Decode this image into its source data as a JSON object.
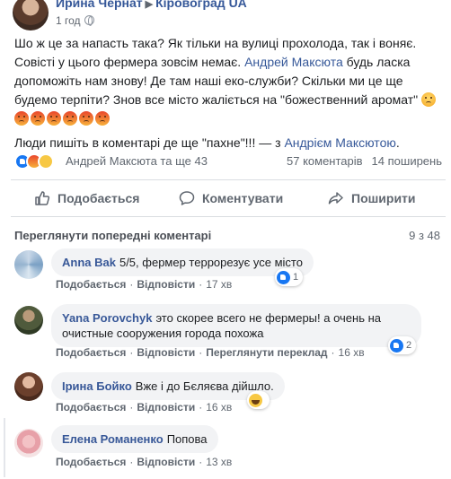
{
  "post": {
    "author": "Ирина Чернат",
    "arrow": "▶",
    "group": "Кіровоград UA",
    "time": "1 год",
    "text": {
      "p1_a": "Шо ж це за напасть така? Як тільки на вулиці прохолода, так і воняє. Совісті у цього фермера зовсім немає. ",
      "mention": "Андрей Максюта",
      "p1_b": " будь ласка допоможіть нам знову! Де там наші еко-служби? Скільки ми це ще будемо терпіти? Знов все місто жаліється на \"божественний аромат\"",
      "p2": "Люди пишіть в коментарі де ще \"пахне\"!!! — з ",
      "tag_person": "Андрієм Максютою",
      "p2_end": "."
    },
    "emoji": [
      "sad",
      "angry",
      "angry",
      "angry",
      "angry",
      "angry",
      "angry"
    ]
  },
  "stats": {
    "reactions_text": "Андрей Максюта та ще 43",
    "comments": "57 коментарів",
    "shares": "14 поширень"
  },
  "actions": {
    "like": "Подобається",
    "comment": "Коментувати",
    "share": "Поширити"
  },
  "comments_section": {
    "previous": "Переглянути попередні коментарі",
    "count": "9 з 48"
  },
  "comments": [
    {
      "name": "Anna Bak",
      "text": "5/5, фермер террорезує усе місто",
      "like": "Подобається",
      "reply": "Відповісти",
      "time": "17 хв",
      "reactions": "1",
      "reaction_icon": "like-icon"
    },
    {
      "name": "Yana Porovchyk",
      "text": "это скорее всего не фермеры! а очень на очистные сооружения города похожа",
      "like": "Подобається",
      "reply": "Відповісти",
      "translate": "Переглянути переклад",
      "time": "16 хв",
      "reactions": "2",
      "reaction_icon": "like-icon"
    },
    {
      "name": "Ірина Бойко",
      "text": "Вже і до Бєляєва дійшло.",
      "like": "Подобається",
      "reply": "Відповісти",
      "time": "16 хв",
      "reactions": "",
      "reaction_icon": "haha-icon"
    },
    {
      "name": "Елена Романенко",
      "text": "Попова",
      "like": "Подобається",
      "reply": "Відповісти",
      "time": "13 хв"
    }
  ]
}
